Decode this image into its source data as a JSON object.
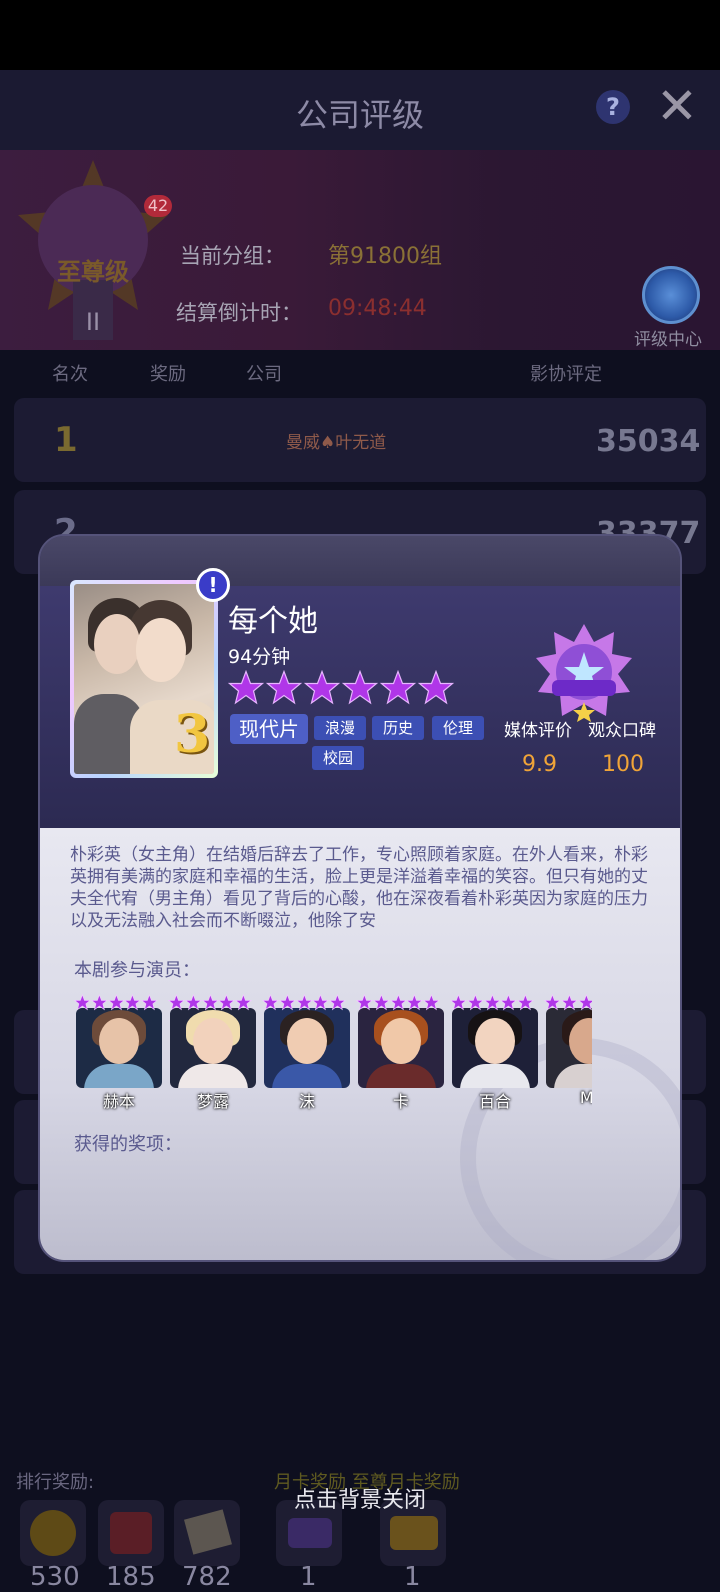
{
  "header": {
    "title": "公司评级",
    "help_glyph": "?",
    "close_glyph": "✕"
  },
  "rank": {
    "tier": "至尊级",
    "level": "II",
    "badge_count": "42"
  },
  "info": {
    "group_label": "当前分组：",
    "group_value": "第91800组",
    "countdown_label": "结算倒计时：",
    "countdown_value": "09:48:44",
    "center_label": "评级中心"
  },
  "columns": {
    "rank": "名次",
    "reward": "奖励",
    "company": "公司",
    "influence": "影协评定"
  },
  "rows": [
    {
      "rank": "1",
      "company": "曼威♠叶无道",
      "score": "35034"
    },
    {
      "rank": "2",
      "score": "33377"
    }
  ],
  "modal": {
    "title": "每个她",
    "duration": "94分钟",
    "star_count": 6,
    "poster_number": "3",
    "alert_glyph": "!",
    "genre_main": "现代片",
    "tags": [
      "浪漫",
      "历史",
      "伦理",
      "校园"
    ],
    "media_label": "媒体评价",
    "media_value": "9.9",
    "audience_label": "观众口碑",
    "audience_value": "100",
    "synopsis": "朴彩英（女主角）在结婚后辞去了工作，专心照顾着家庭。在外人看来，朴彩英拥有美满的家庭和幸福的生活，脸上更是洋溢着幸福的笑容。但只有她的丈夫全代宥（男主角）看见了背后的心酸，他在深夜看着朴彩英因为家庭的压力以及无法融入社会而不断啜泣，他除了安",
    "cast_label": "本剧参与演员：",
    "cast": [
      {
        "name": "赫本"
      },
      {
        "name": "梦露"
      },
      {
        "name": "沫"
      },
      {
        "name": "卡"
      },
      {
        "name": "百合"
      },
      {
        "name": "Mi"
      }
    ],
    "awards_label": "获得的奖项："
  },
  "rewards": {
    "label": "排行奖励:",
    "tabs_label": "月卡奖励  至尊月卡奖励",
    "items": [
      {
        "icon": "coin-icon",
        "count": "530"
      },
      {
        "icon": "gift-box-icon",
        "count": "185"
      },
      {
        "icon": "script-icon",
        "count": "782"
      },
      {
        "icon": "ticket-icon",
        "count": "1"
      },
      {
        "icon": "card-icon",
        "count": "1"
      }
    ]
  },
  "close_hint": "点击背景关闭",
  "colors": {
    "accent_gold": "#f0a438",
    "star_purple": "#b036e8",
    "tag_blue": "#3c4fb4"
  }
}
